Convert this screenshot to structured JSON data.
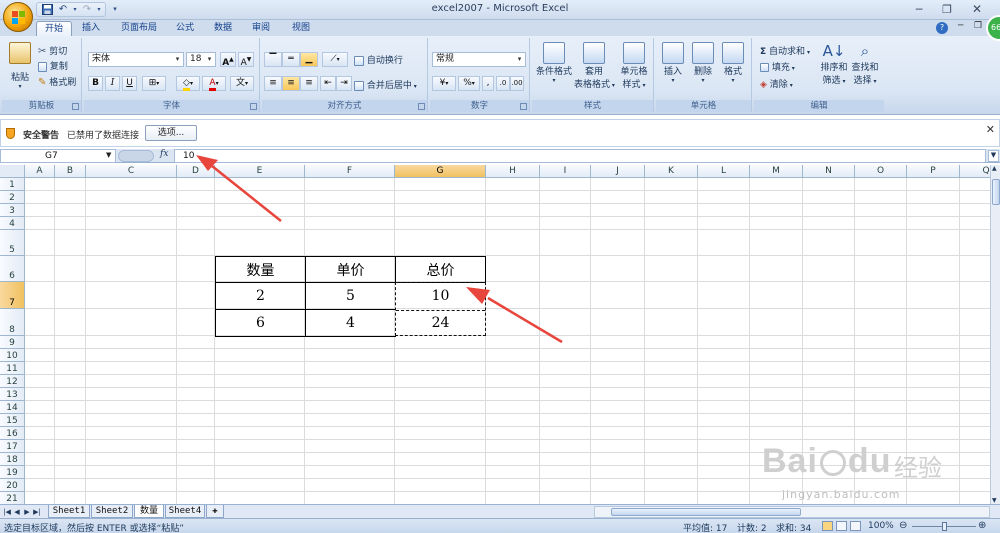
{
  "window": {
    "title": "excel2007 - Microsoft Excel"
  },
  "quick_access": {
    "icons": [
      "save-icon",
      "undo-icon",
      "redo-icon",
      "customize-icon"
    ]
  },
  "tabs": [
    "开始",
    "插入",
    "页面布局",
    "公式",
    "数据",
    "审阅",
    "视图"
  ],
  "avatar_badge": "66",
  "ribbon": {
    "clipboard": {
      "paste": "粘贴",
      "cut": "剪切",
      "copy": "复制",
      "format_painter": "格式刷",
      "label": "剪贴板"
    },
    "font": {
      "name": "宋体",
      "size": "18",
      "bold": "B",
      "italic": "I",
      "underline": "U",
      "label": "字体"
    },
    "alignment": {
      "wrap": "自动换行",
      "merge": "合并后居中",
      "label": "对齐方式"
    },
    "number": {
      "format": "常规",
      "percent": "%",
      "comma": ",",
      "label": "数字"
    },
    "styles": {
      "conditional": "条件格式",
      "table_line1": "套用",
      "table_line2": "表格格式",
      "cell_line1": "单元格",
      "cell_line2": "样式",
      "label": "样式"
    },
    "cells": {
      "insert": "插入",
      "delete": "删除",
      "format": "格式",
      "label": "单元格"
    },
    "editing": {
      "autosum": "自动求和",
      "fill": "填充",
      "clear": "清除",
      "sort_line1": "排序和",
      "sort_line2": "筛选",
      "find_line1": "查找和",
      "find_line2": "选择",
      "label": "编辑"
    }
  },
  "security_bar": {
    "title": "安全警告",
    "message": "已禁用了数据连接",
    "button": "选项..."
  },
  "formula_bar": {
    "name_box": "G7",
    "fx": "fx",
    "value": "10"
  },
  "columns": [
    "A",
    "B",
    "C",
    "D",
    "E",
    "F",
    "G",
    "H",
    "I",
    "J",
    "K",
    "L",
    "M",
    "N",
    "O",
    "P",
    "Q"
  ],
  "rows": [
    "1",
    "2",
    "3",
    "4",
    "5",
    "6",
    "7",
    "8",
    "9",
    "10",
    "11",
    "12",
    "13",
    "14",
    "15",
    "16",
    "17",
    "18",
    "19",
    "20",
    "21"
  ],
  "table": {
    "headers": [
      "数量",
      "单价",
      "总价"
    ],
    "rows": [
      [
        "2",
        "5",
        "10"
      ],
      [
        "6",
        "4",
        "24"
      ]
    ]
  },
  "sheets": [
    "Sheet1",
    "Sheet2",
    "数量",
    "Sheet4"
  ],
  "status": {
    "message": "选定目标区域，然后按 ENTER 或选择“粘贴”",
    "average": "平均值: 17",
    "count": "计数: 2",
    "sum": "求和: 34",
    "zoom": "100%"
  },
  "watermark": {
    "brand": "Bai",
    "brand2": "du",
    "cn": "经验",
    "url": "jingyan.baidu.com"
  },
  "colors": {
    "accent": "#e8453c",
    "ribbon": "#dbe6f4",
    "selected_header": "#f1c15f"
  }
}
